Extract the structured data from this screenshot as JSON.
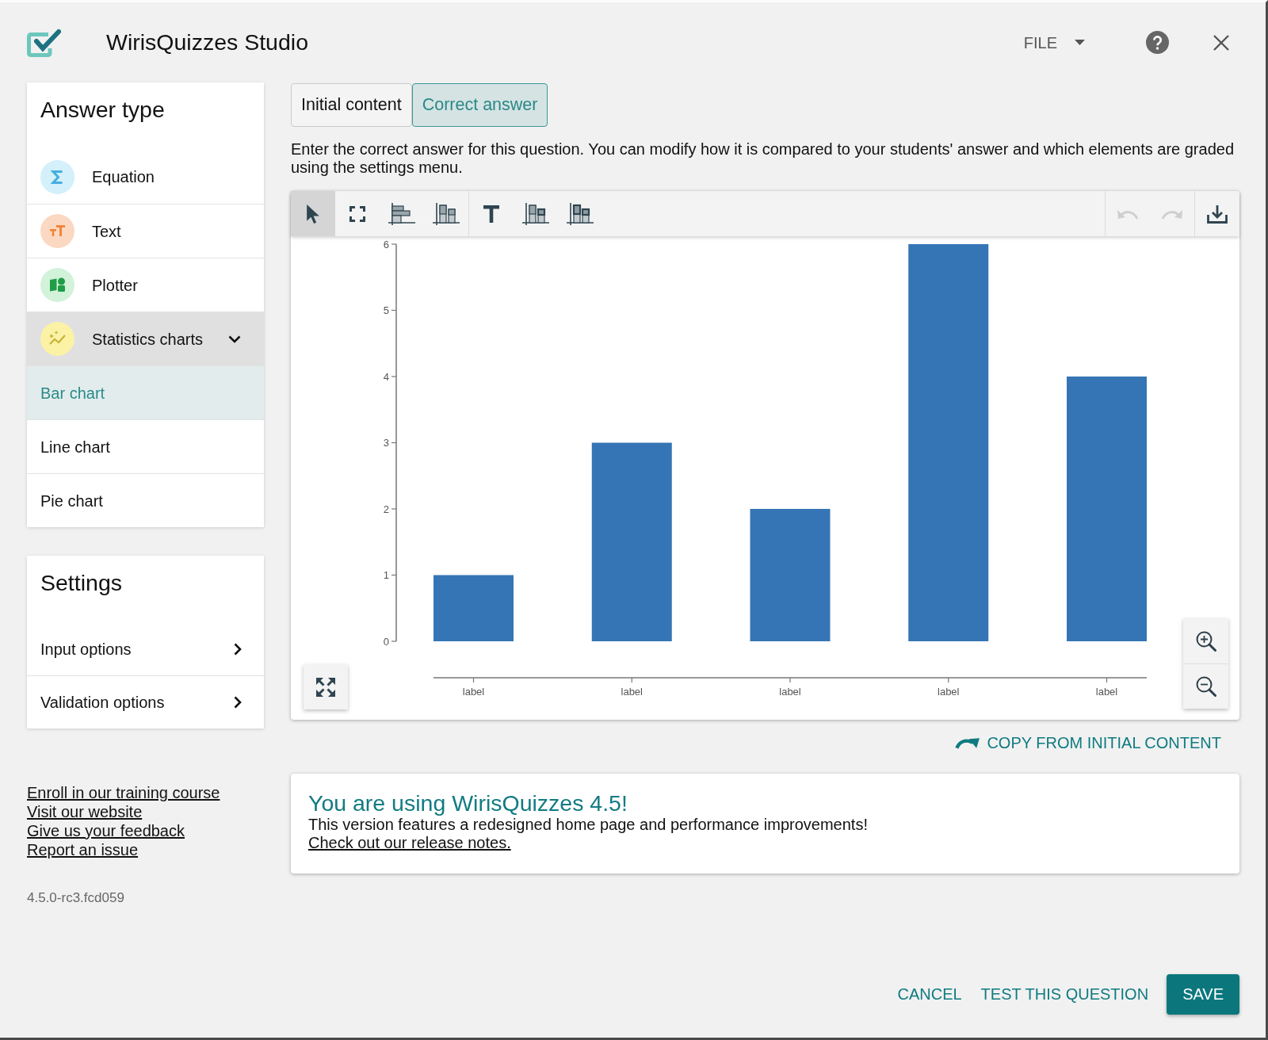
{
  "dialog": {
    "title": "WirisQuizzes Studio",
    "menu": "FILE"
  },
  "answer_type": {
    "heading": "Answer type",
    "items": [
      {
        "label": "Equation",
        "kind": "equation",
        "selected": false,
        "expanded": false
      },
      {
        "label": "Text",
        "kind": "text",
        "selected": false,
        "expanded": false
      },
      {
        "label": "Plotter",
        "kind": "plotter",
        "selected": false,
        "expanded": false
      },
      {
        "label": "Statistics charts",
        "kind": "statistics",
        "selected": false,
        "expanded": true,
        "children": [
          {
            "label": "Bar chart",
            "selected": true
          },
          {
            "label": "Line chart",
            "selected": false
          },
          {
            "label": "Pie chart",
            "selected": false
          }
        ]
      }
    ]
  },
  "settings": {
    "heading": "Settings",
    "items": [
      {
        "label": "Input options"
      },
      {
        "label": "Validation options"
      }
    ]
  },
  "links": [
    "Enroll in our training course",
    "Visit our website",
    "Give us your feedback",
    "Report an issue"
  ],
  "version": "4.5.0-rc3.fcd059",
  "tabs": [
    {
      "label": "Initial content",
      "selected": false
    },
    {
      "label": "Correct answer",
      "selected": true
    }
  ],
  "instructions": "Enter the correct answer for this question. You can modify how it is compared to your students' answer and which elements are graded using the settings menu.",
  "toolbar": {
    "tool_groups": [
      [
        {
          "kind": "pointer",
          "selected": true
        },
        {
          "kind": "frame",
          "selected": false
        },
        {
          "kind": "hbars",
          "selected": false
        },
        {
          "kind": "vbars",
          "selected": false
        }
      ],
      [
        {
          "kind": "label",
          "selected": false
        },
        {
          "kind": "barfill",
          "selected": false
        },
        {
          "kind": "barmark",
          "selected": false
        }
      ]
    ],
    "action_groups": [
      [
        {
          "kind": "undo",
          "disabled": true
        },
        {
          "kind": "redo",
          "disabled": true
        }
      ],
      [
        {
          "kind": "download",
          "disabled": false
        }
      ]
    ]
  },
  "chart": {
    "chart_data": {
      "type": "bar",
      "categories": [
        "label",
        "label",
        "label",
        "label",
        "label"
      ],
      "values": [
        1,
        3,
        2,
        6,
        4
      ],
      "ylim": [
        0,
        6
      ],
      "yticks": [
        0,
        1,
        2,
        3,
        4,
        5,
        6
      ]
    }
  },
  "copy_action": "COPY FROM INITIAL CONTENT",
  "notice": {
    "title": "You are using WirisQuizzes 4.5!",
    "body": "This version features a redesigned home page and performance improvements!",
    "link": "Check out our release notes."
  },
  "footer": {
    "buttons": [
      {
        "label": "CANCEL",
        "kind": "text"
      },
      {
        "label": "TEST THIS QUESTION",
        "kind": "text"
      },
      {
        "label": "SAVE",
        "kind": "primary"
      }
    ]
  }
}
